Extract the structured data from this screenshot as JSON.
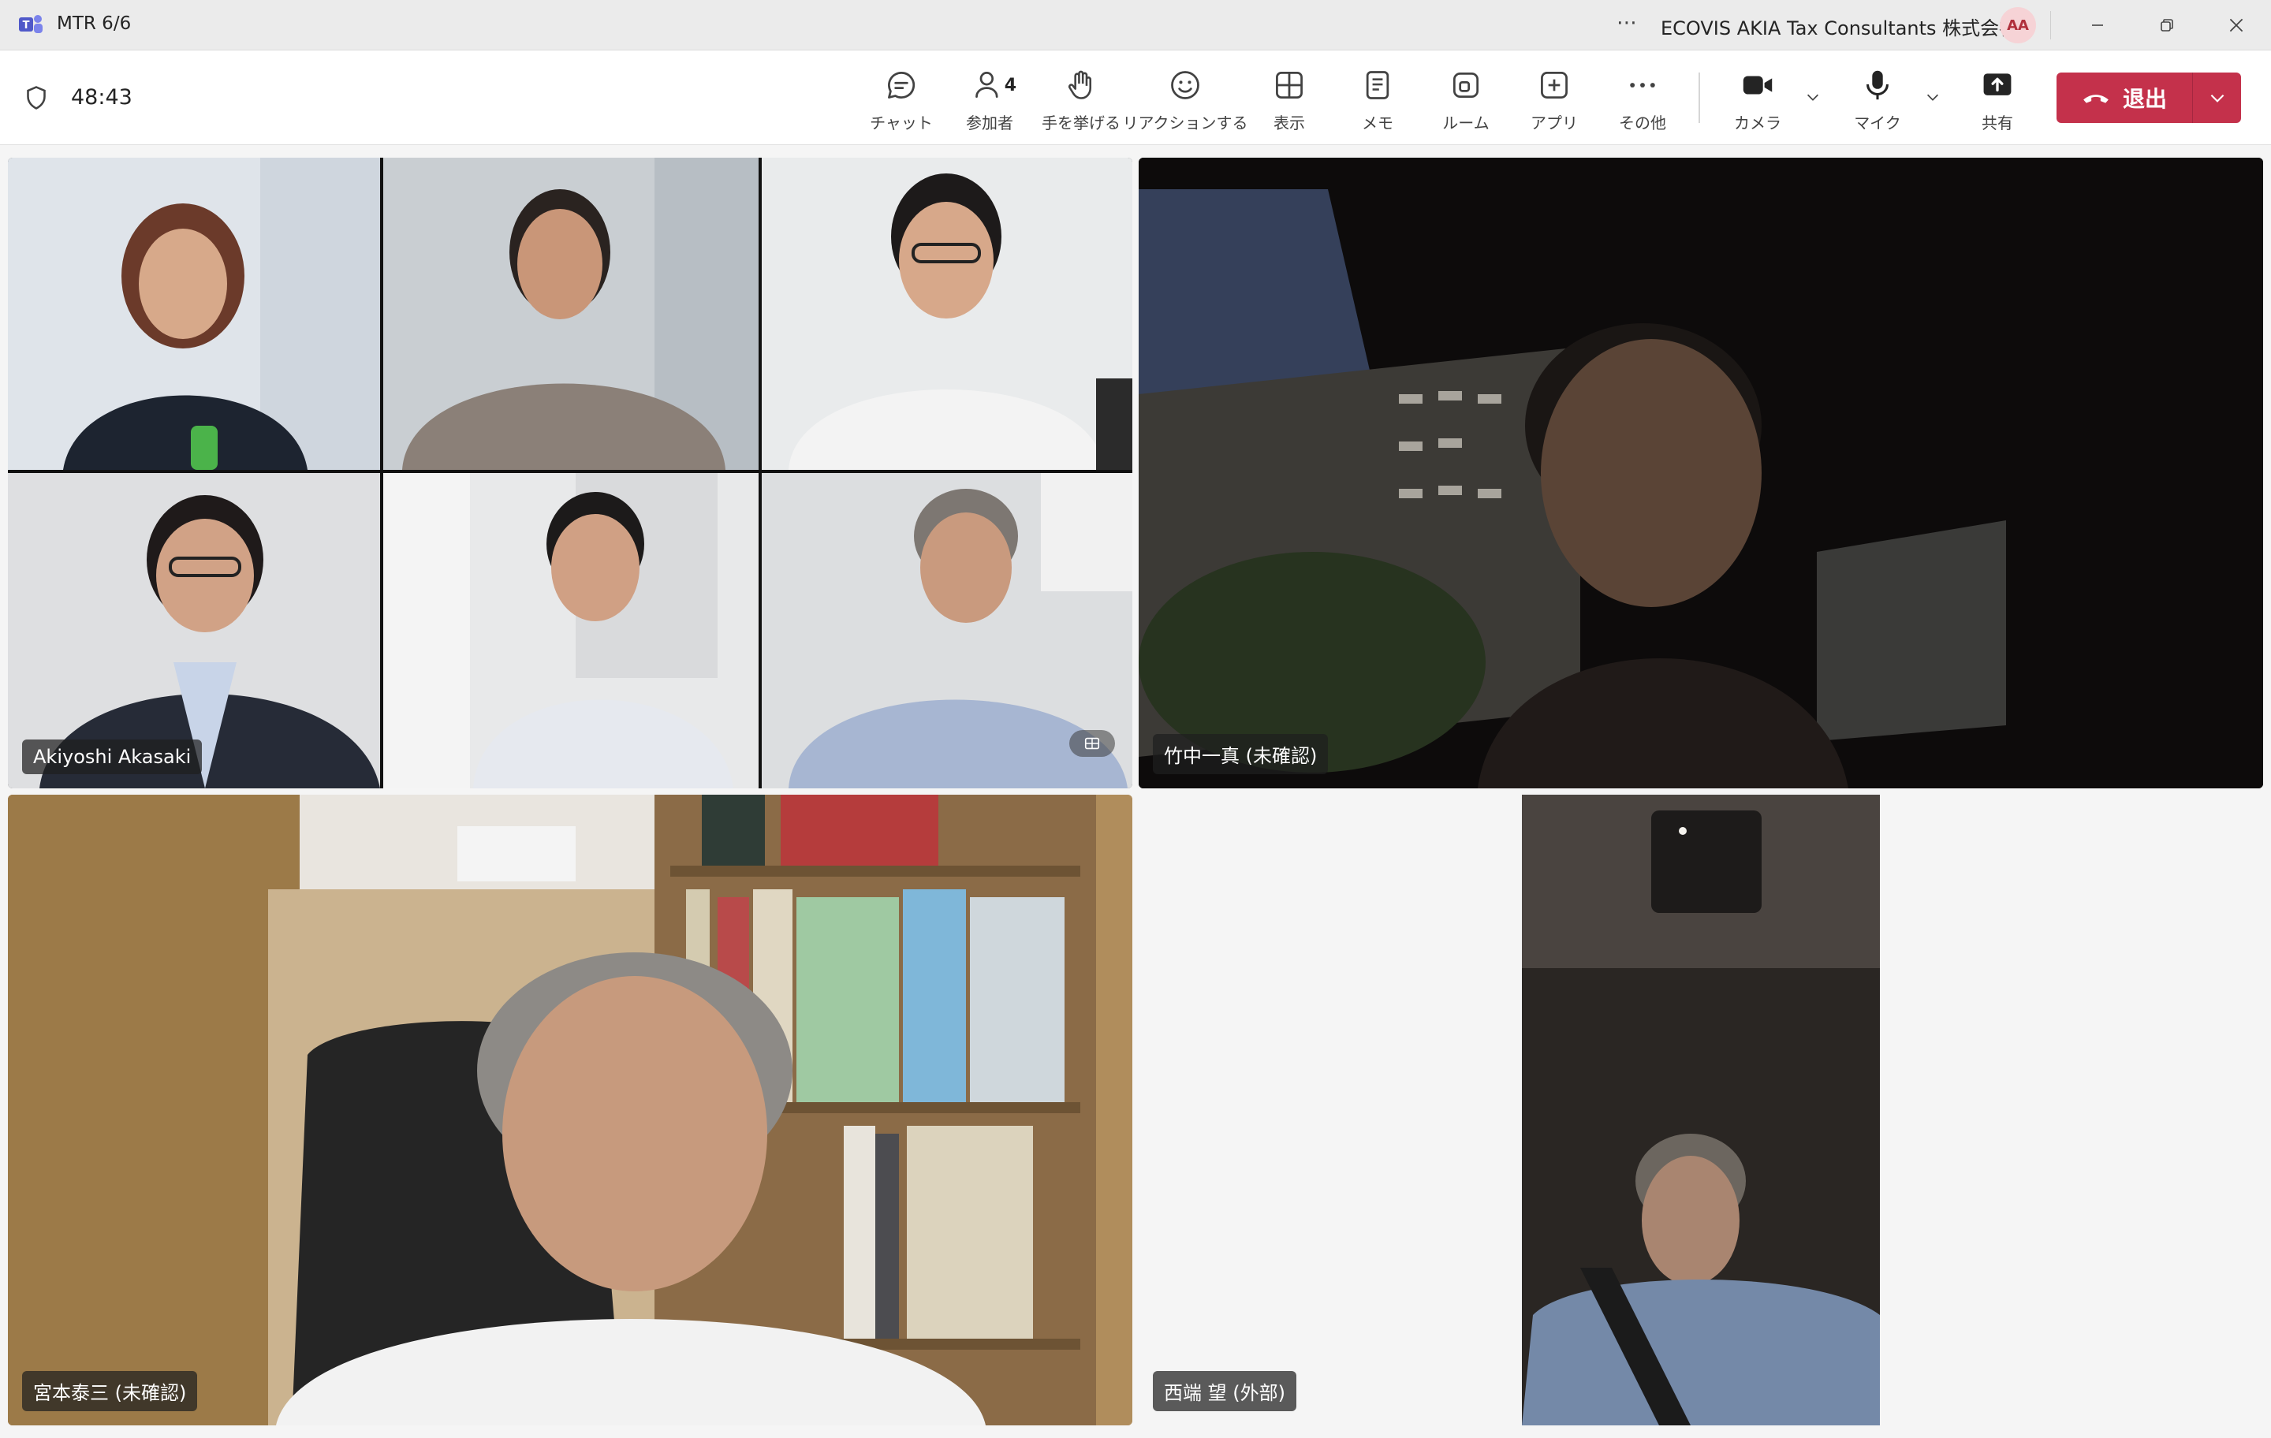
{
  "window": {
    "title": "MTR 6/6",
    "more_dots": "⋯",
    "org_name": "ECOVIS AKIA Tax Consultants 株式会社",
    "avatar_initials": "AA"
  },
  "toolbar": {
    "timer": "48:43",
    "tools": [
      {
        "label": "チャット"
      },
      {
        "label": "参加者",
        "count": "4"
      },
      {
        "label": "手を挙げる"
      },
      {
        "label": "リアクションする"
      },
      {
        "label": "表示"
      },
      {
        "label": "メモ"
      },
      {
        "label": "ルーム"
      },
      {
        "label": "アプリ"
      },
      {
        "label": "その他"
      }
    ],
    "camera_label": "カメラ",
    "mic_label": "マイク",
    "share_label": "共有",
    "leave_label": "退出"
  },
  "tiles": {
    "room_grid_name": "Akiyoshi Akasaki",
    "car_tile_name": "竹中一真 (未確認)",
    "office_tile_name": "宮本泰三 (未確認)",
    "portrait_tile_name": "西端 望 (外部)"
  },
  "colors": {
    "leave_button": "#c4314b",
    "titlebar_bg": "#ebebeb",
    "toolbar_bg": "#ffffff",
    "stage_bg": "#f5f5f5",
    "avatar_bg": "#f6d3d6"
  }
}
